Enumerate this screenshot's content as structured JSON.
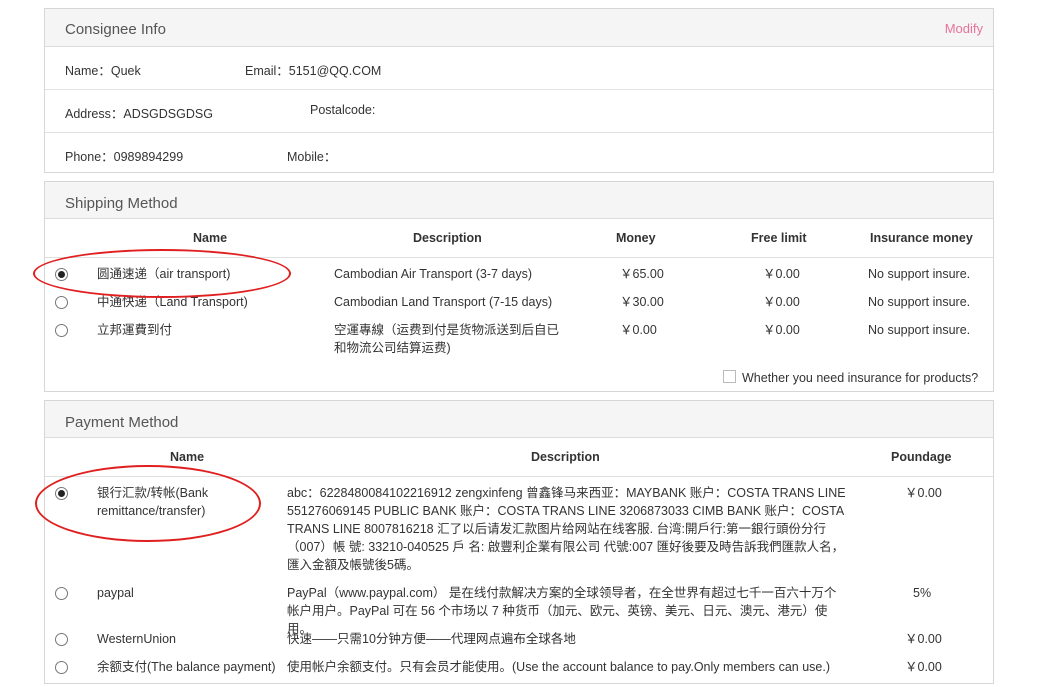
{
  "consignee": {
    "title": "Consignee Info",
    "modify": "Modify",
    "name_label": "Name：Quek",
    "email_label": "Email：5151@QQ.COM",
    "address_label": "Address：ADSGDSGDSG",
    "postalcode_label": "Postalcode:",
    "phone_label": "Phone：0989894299",
    "mobile_label": "Mobile："
  },
  "shipping": {
    "title": "Shipping Method",
    "headers": {
      "name": "Name",
      "description": "Description",
      "money": "Money",
      "free": "Free limit",
      "insurance": "Insurance money"
    },
    "rows": [
      {
        "name": "圆通速递（air transport)",
        "description": "Cambodian Air Transport (3-7 days)",
        "money": "￥65.00",
        "free": "￥0.00",
        "insurance": "No support insure.",
        "selected": true
      },
      {
        "name": "中通快递（Land Transport)",
        "description": "Cambodian Land Transport (7-15 days)",
        "money": "￥30.00",
        "free": "￥0.00",
        "insurance": "No support insure.",
        "selected": false
      },
      {
        "name": "立邦運費到付",
        "description": "空運專線（运费到付是货物派送到后自已和物流公司结算运费)",
        "money": "￥0.00",
        "free": "￥0.00",
        "insurance": "No support insure.",
        "selected": false
      }
    ],
    "insurance_question": "Whether you need insurance for products?"
  },
  "payment": {
    "title": "Payment Method",
    "headers": {
      "name": "Name",
      "description": "Description",
      "poundage": "Poundage"
    },
    "rows": [
      {
        "name": "银行汇款/转帐(Bank remittance/transfer)",
        "description": "abc：6228480084102216912 zengxinfeng 曾鑫锋马来西亚：MAYBANK 账户：COSTA TRANS LINE 551276069145 PUBLIC BANK 账户：COSTA TRANS LINE 3206873033 CIMB BANK 账户：COSTA TRANS LINE 8007816218 汇了以后请发汇款图片给网站在线客服. 台湾:開戶行:第一銀行頭份分行（007）帳 號: 33210-040525 戶 名: 啟豐利企業有限公司 代號:007 匯好後要及時告訴我們匯款人名，匯入金額及帳號後5碼。",
        "poundage": "￥0.00",
        "selected": true
      },
      {
        "name": "paypal",
        "description": "PayPal（www.paypal.com） 是在线付款解决方案的全球领导者，在全世界有超过七千一百六十万个帐户用户。PayPal 可在 56 个市场以 7 种货币（加元、欧元、英镑、美元、日元、澳元、港元）使用。",
        "poundage": "5%",
        "selected": false
      },
      {
        "name": "WesternUnion",
        "description": "快速——只需10分钟方便——代理网点遍布全球各地",
        "poundage": "￥0.00",
        "selected": false
      },
      {
        "name": "余额支付(The balance payment)",
        "description": "使用帐户余额支付。只有会员才能使用。(Use the account balance to pay.Only members can use.)",
        "poundage": "￥0.00",
        "selected": false
      }
    ]
  },
  "colors": {
    "accent": "#e8739a",
    "annotation": "#e02020"
  }
}
